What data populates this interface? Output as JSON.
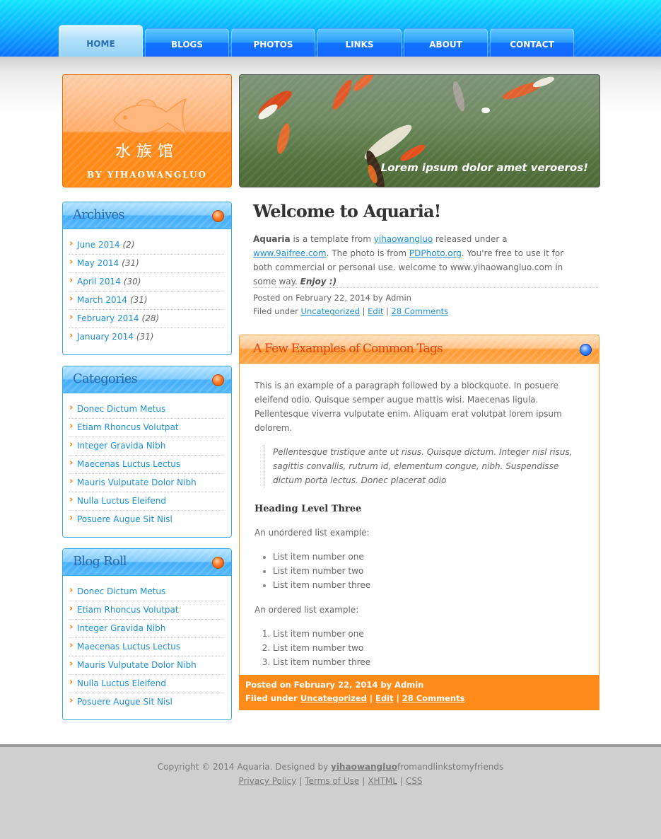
{
  "nav": {
    "tabs": [
      {
        "label": "HOME",
        "active": true
      },
      {
        "label": "BLOGS",
        "active": false
      },
      {
        "label": "PHOTOS",
        "active": false
      },
      {
        "label": "LINKS",
        "active": false
      },
      {
        "label": "ABOUT",
        "active": false
      },
      {
        "label": "CONTACT",
        "active": false
      }
    ]
  },
  "logo": {
    "title": "水族馆",
    "subtitle": "BY YIHAOWANGLUO",
    "icon": "fish-icon"
  },
  "banner": {
    "caption": "Lorem ipsum dolor amet veroeros!"
  },
  "sidebar": {
    "archives": {
      "title": "Archives",
      "items": [
        {
          "label": "June 2014",
          "count": "(2)"
        },
        {
          "label": "May 2014",
          "count": "(31)"
        },
        {
          "label": "April 2014",
          "count": "(30)"
        },
        {
          "label": "March 2014",
          "count": "(31)"
        },
        {
          "label": "February 2014",
          "count": "(28)"
        },
        {
          "label": "January 2014",
          "count": "(31)"
        }
      ]
    },
    "categories": {
      "title": "Categories",
      "items": [
        "Donec Dictum Metus",
        "Etiam Rhoncus Volutpat",
        "Integer Gravida Nibh",
        "Maecenas Luctus Lectus",
        "Mauris Vulputate Dolor Nibh",
        "Nulla Luctus Eleifend",
        "Posuere Augue Sit Nisl"
      ]
    },
    "blogroll": {
      "title": "Blog Roll",
      "items": [
        "Donec Dictum Metus",
        "Etiam Rhoncus Volutpat",
        "Integer Gravida Nibh",
        "Maecenas Luctus Lectus",
        "Mauris Vulputate Dolor Nibh",
        "Nulla Luctus Eleifend",
        "Posuere Augue Sit Nisl"
      ]
    }
  },
  "post": {
    "title": "Welcome to Aquaria!",
    "brand": "Aquaria",
    "t1": " is a template from ",
    "link1": "yihaowangluo",
    "t2": " released under a ",
    "link2": "www.9aifree.com",
    "t3": ". The photo is from ",
    "link3": "PDPhoto.org",
    "t4": ". You're free to use it for both commercial or personal use. welcome to www.yihaowangluo.com in some way. ",
    "enjoy": "Enjoy :)",
    "meta_posted": "Posted on February 22, 2014 by Admin",
    "meta_filed": "Filed under ",
    "meta_cat": "Uncategorized",
    "meta_edit": "Edit",
    "meta_comments": "28 Comments"
  },
  "examples": {
    "title": "A Few Examples of Common Tags",
    "paragraph": "This is an example of a paragraph followed by a blockquote. In posuere eleifend odio. Quisque semper augue mattis wisi. Maecenas ligula. Pellentesque viverra vulputate enim. Aliquam erat volutpat lorem ipsum dolorem.",
    "quote": "Pellentesque tristique ante ut risus. Quisque dictum. Integer nisl risus, sagittis convallis, rutrum id, elementum congue, nibh. Suspendisse dictum porta lectus. Donec placerat odio",
    "heading": "Heading Level Three",
    "ul_label": "An unordered list example:",
    "ul": [
      "List item number one",
      "List item number two",
      "List item number three"
    ],
    "ol_label": "An ordered list example:",
    "ol": [
      "List item number one",
      "List item number two",
      "List item number three"
    ],
    "foot_posted": "Posted on February 22, 2014 by Admin",
    "foot_filed": "Filed under ",
    "foot_cat": "Uncategorized",
    "foot_edit": "Edit",
    "foot_comments": "28 Comments"
  },
  "footer": {
    "copyright": "Copyright © 2014 Aquaria. Designed by ",
    "designer": "yihaowangluo",
    "tail": "fromandlinkstomyfriends",
    "links": [
      "Privacy Policy",
      "Terms of Use",
      "XHTML",
      "CSS"
    ]
  },
  "colors": {
    "nav_blue": "#0a72ff",
    "accent_orange": "#ff8c1a",
    "link_blue": "#1d8fd8",
    "widget_border": "#3aa9e2"
  }
}
